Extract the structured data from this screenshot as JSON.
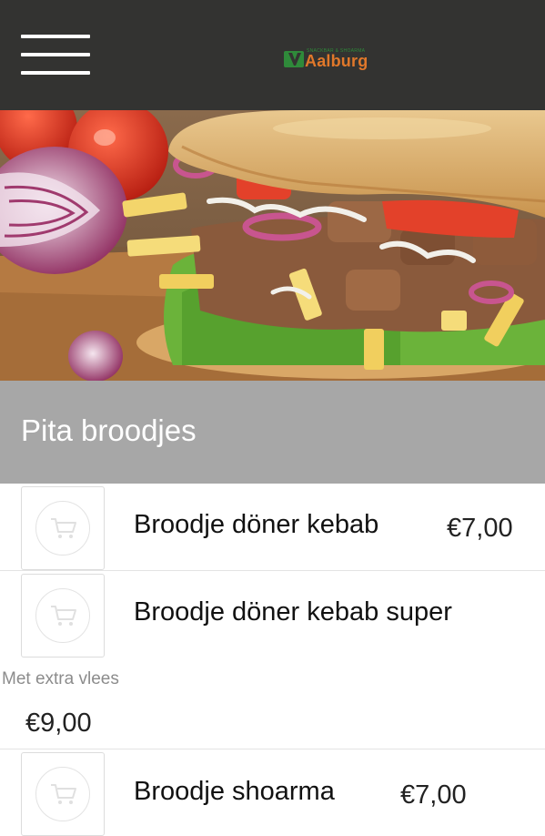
{
  "header": {
    "logo_tagline": "SNACKBAR & SHOARMA",
    "logo_text": "Aalburg",
    "colors": {
      "background": "#333331",
      "logo_mark": "#2f8a3a",
      "logo_text": "#e0782a"
    }
  },
  "category": {
    "title": "Pita broodjes",
    "band_color": "#a7a7a7"
  },
  "products": [
    {
      "name": "Broodje döner kebab",
      "price": "€7,00",
      "icon": "shopping-cart-icon"
    },
    {
      "name": "Broodje döner kebab super",
      "description": "Met extra vlees",
      "price": "€9,00",
      "icon": "shopping-cart-icon"
    },
    {
      "name": "Broodje shoarma",
      "price": "€7,00",
      "icon": "shopping-cart-icon"
    }
  ]
}
